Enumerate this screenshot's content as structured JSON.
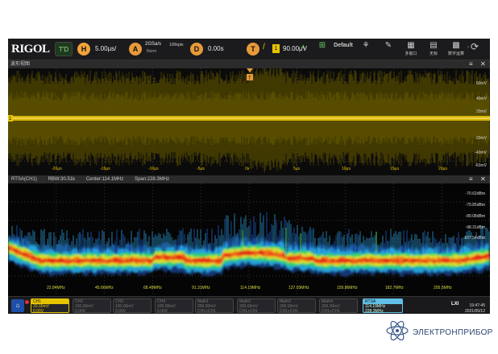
{
  "toolbar": {
    "logo": "RIGOL",
    "trigger_mode": "T'D",
    "horizontal_icon": "H",
    "timebase": "5.00µs/",
    "acquire_icon": "A",
    "sample_rate": "2GSa/s",
    "memory_depth": "100kpts",
    "acquire_mode": "Norm",
    "delay_icon": "D",
    "delay": "0.00s",
    "trigger_icon": "T",
    "trigger_source": "1",
    "trigger_level": "90.00μV",
    "trigger_slope_glyph": "/",
    "trigger_edge_label": "A",
    "buttons": [
      {
        "label": "",
        "icon": "auto-icon"
      },
      {
        "label": "Default",
        "icon": "default-icon"
      },
      {
        "label": "",
        "icon": "clear-icon"
      },
      {
        "label": "",
        "icon": "quick-icon"
      },
      {
        "label": "多窗口",
        "icon": "multiwindow-icon"
      },
      {
        "label": "无标",
        "icon": "grid-icon"
      },
      {
        "label": "数字运算",
        "icon": "math-icon"
      }
    ]
  },
  "waveform_window": {
    "title": "波形视图",
    "y_labels": [
      "60mV",
      "40mV",
      "20mV",
      "",
      "-20mV",
      "-40mV",
      "-60mV"
    ],
    "x_labels": [
      "-20µs",
      "-15µs",
      "-10µs",
      "-5µs",
      "0s",
      "5µs",
      "10µs",
      "15µs",
      "20µs"
    ],
    "channel_marker": "1",
    "trigger_marker": "T",
    "colors": {
      "trace": "#e7c400",
      "noise": "#5b5000"
    }
  },
  "spectrum_window": {
    "title": "RTSA(CH1)",
    "rbw": "RBW:30.51k",
    "center": "Center:114.1MHz",
    "span": "Span:228.3MHz",
    "y_labels": [
      "-70.62dBm",
      "-79.85dBm",
      "-89.08dBm",
      "-98.31dBm",
      "-107.54dBm"
    ],
    "x_labels": [
      "22.84MHz",
      "45.66MHz",
      "68.49MHz",
      "91.31MHz",
      "114.19MHz",
      "137.03MHz",
      "159.86MHz",
      "182.7MHz",
      "205.5MHz"
    ]
  },
  "bottom_bar": {
    "channels": [
      {
        "name": "CH1",
        "scale": "20.00mV",
        "offset": "0.00V",
        "active": true
      },
      {
        "name": "CH2",
        "scale": "100.00mV",
        "offset": "0.00V"
      },
      {
        "name": "CH3",
        "scale": "100.00mV",
        "offset": "0.00V"
      },
      {
        "name": "CH4",
        "scale": "100.00mV",
        "offset": "0.00V"
      },
      {
        "name": "Math1",
        "scale": "300.00mV",
        "offset": "CH1+CH1"
      },
      {
        "name": "Math2",
        "scale": "300.00mV",
        "offset": "CH1+CH1"
      },
      {
        "name": "Math3",
        "scale": "300.00mV",
        "offset": "CH1+CH1"
      },
      {
        "name": "Math4",
        "scale": "300.00mV",
        "offset": "CH1+CH1"
      }
    ],
    "rtsa": {
      "name": "RTSA",
      "center": "114.19MHz",
      "span": "228.3MHz"
    },
    "lan": "LXI",
    "time": "19:47:45",
    "date": "2021/05/12"
  },
  "brand": {
    "name": "ЭЛЕКТРОНПРИБОР"
  }
}
